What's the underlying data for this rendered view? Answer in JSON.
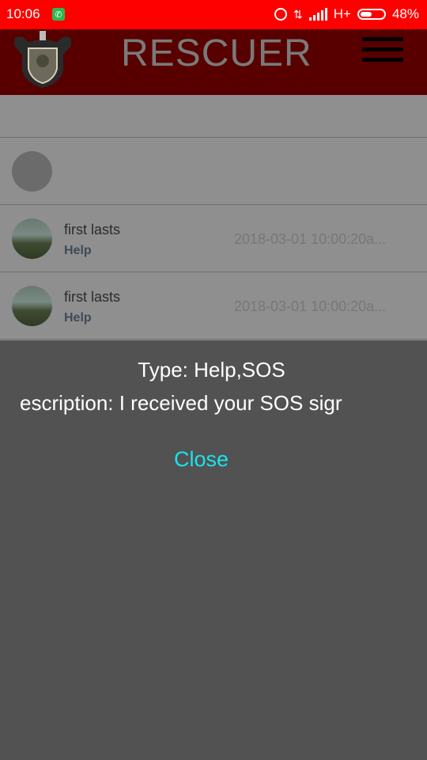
{
  "status_bar": {
    "time": "10:06",
    "network": "H+",
    "battery": "48%"
  },
  "header": {
    "title": "RESCUER"
  },
  "list": {
    "items": [
      {
        "name": "first lasts",
        "type": "Help",
        "time": "2018-03-01 10:00:20a..."
      },
      {
        "name": "first lasts",
        "type": "Help",
        "time": "2018-03-01 10:00:20a..."
      }
    ]
  },
  "dialog": {
    "type_line": "Type: Help,SOS",
    "description_line": "escription: I received your SOS sigr",
    "close_label": "Close"
  },
  "colors": {
    "status_bar": "#ff0000",
    "header": "#580000",
    "close_text": "#19e4ec"
  }
}
